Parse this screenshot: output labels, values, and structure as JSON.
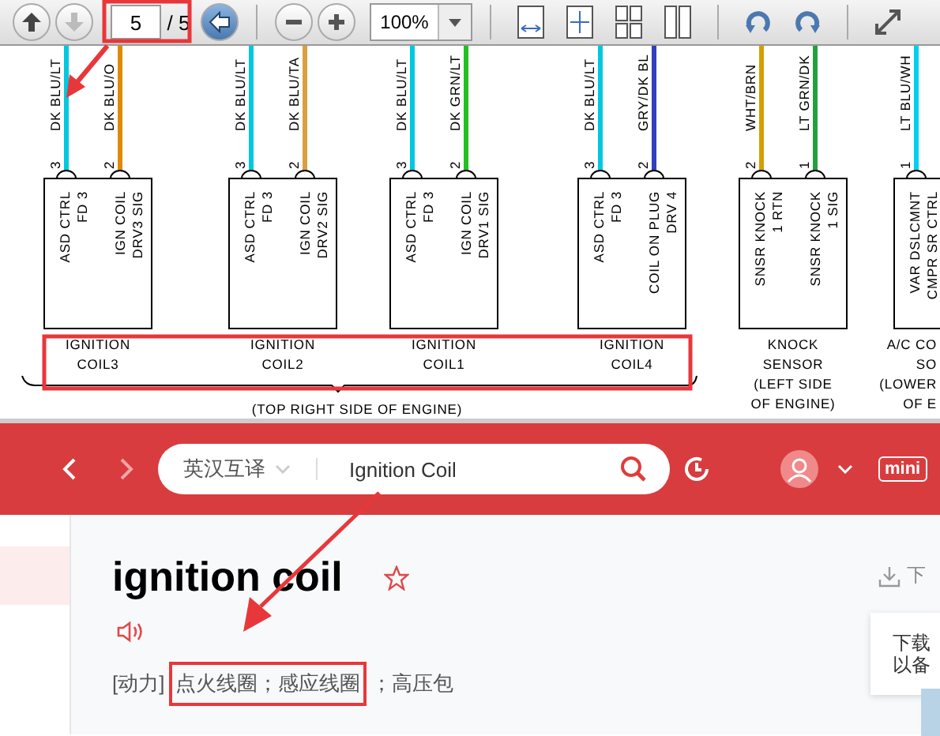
{
  "pdf_toolbar": {
    "page": "5",
    "page_total": "/ 5",
    "zoom": "100%"
  },
  "wiring_diagram": {
    "connectors": [
      {
        "pins": [
          {
            "number": "3",
            "wire": "DK BLU/LT",
            "color": "#00c8e0"
          },
          {
            "number": "2",
            "wire": "DK BLU/O",
            "color": "#e08a00"
          }
        ],
        "columns": [
          [
            "ASD CTRL",
            "FD 3"
          ],
          [
            "IGN COIL",
            "DRV3 SIG"
          ]
        ],
        "caption": [
          "IGNITION",
          "COIL3"
        ]
      },
      {
        "pins": [
          {
            "number": "3",
            "wire": "DK BLU/LT",
            "color": "#00c8e0"
          },
          {
            "number": "2",
            "wire": "DK BLU/TA",
            "color": "#d9a040"
          }
        ],
        "columns": [
          [
            "ASD CTRL",
            "FD 3"
          ],
          [
            "IGN COIL",
            "DRV2 SIG"
          ]
        ],
        "caption": [
          "IGNITION",
          "COIL2"
        ]
      },
      {
        "pins": [
          {
            "number": "3",
            "wire": "DK BLU/LT",
            "color": "#00c8e0"
          },
          {
            "number": "2",
            "wire": "DK GRN/LT",
            "color": "#22c022"
          }
        ],
        "columns": [
          [
            "ASD CTRL",
            "FD 3"
          ],
          [
            "IGN COIL",
            "DRV1 SIG"
          ]
        ],
        "caption": [
          "IGNITION",
          "COIL1"
        ]
      },
      {
        "pins": [
          {
            "number": "3",
            "wire": "DK BLU/LT",
            "color": "#00c8e0"
          },
          {
            "number": "2",
            "wire": "GRY/DK BL",
            "color": "#3040c0"
          }
        ],
        "columns": [
          [
            "ASD CTRL",
            "FD 3"
          ],
          [
            "COIL ON PLUG",
            "DRV 4"
          ]
        ],
        "caption": [
          "IGNITION",
          "COIL4"
        ]
      },
      {
        "pins": [
          {
            "number": "2",
            "wire": "WHT/BRN",
            "color": "#d4a000"
          },
          {
            "number": "1",
            "wire": "LT GRN/DK",
            "color": "#22a040"
          }
        ],
        "columns": [
          [
            "SNSR KNOCK",
            "1 RTN"
          ],
          [
            "SNSR KNOCK",
            "1 SIG"
          ]
        ],
        "caption": [
          "KNOCK",
          "SENSOR",
          "(LEFT SIDE",
          "OF ENGINE)"
        ]
      },
      {
        "pins": [
          {
            "number": "1",
            "wire": "LT BLU/WH",
            "color": "#00d0f0"
          }
        ],
        "columns": [
          [
            "VAR DSLCMNT",
            "CMPR SR CTRL"
          ]
        ],
        "caption": [
          "A/C CO",
          "SO",
          "(LOWER",
          "OF E"
        ]
      }
    ],
    "group_label": "(TOP RIGHT SIDE OF ENGINE)"
  },
  "dictionary": {
    "search": {
      "mode": "英汉互译",
      "value": "Ignition Coil"
    },
    "headword": "ignition coil",
    "definition": [
      {
        "text": "[动力]",
        "highlighted": false
      },
      {
        "text": "点火线圈；感应线圈",
        "highlighted": true
      },
      {
        "text": "；高压包",
        "highlighted": false
      }
    ],
    "download": "下",
    "mini_button": "mini",
    "tooltip": [
      "下载",
      "以备"
    ]
  }
}
